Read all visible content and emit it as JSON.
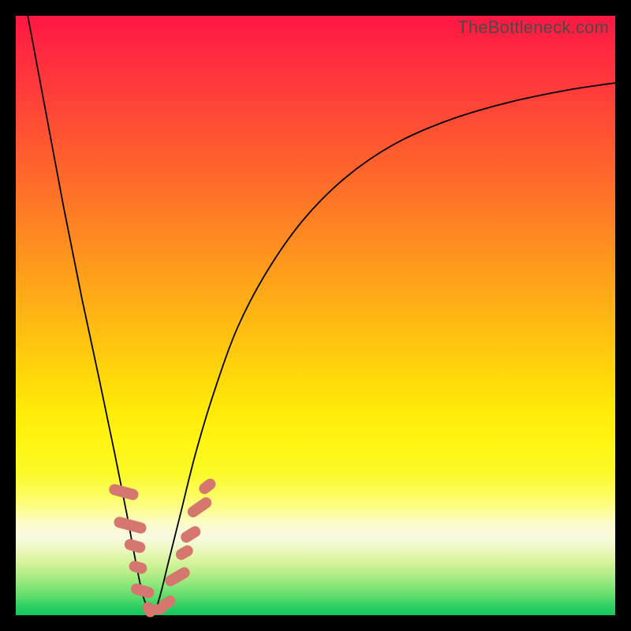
{
  "attribution": "TheBottleneck.com",
  "chart_data": {
    "type": "line",
    "title": "",
    "xlabel": "",
    "ylabel": "",
    "xlim": [
      0,
      100
    ],
    "ylim": [
      0,
      100
    ],
    "series": [
      {
        "name": "bottleneck-curve",
        "x": [
          2,
          5,
          8,
          11,
          14,
          16.5,
          18.5,
          20,
          21.3,
          22.8,
          24,
          25.5,
          27.5,
          30,
          33,
          37,
          42,
          48,
          55,
          63,
          72,
          82,
          92,
          100
        ],
        "y": [
          100,
          84,
          68,
          53,
          39,
          27,
          17,
          9,
          3,
          0,
          3,
          9,
          17,
          27,
          37,
          48,
          57.5,
          66,
          73,
          78.5,
          82.5,
          85.5,
          87.6,
          88.8
        ]
      }
    ],
    "markers": {
      "name": "data-points",
      "shape": "pill",
      "color": "#d5776e",
      "points": [
        {
          "x": 18.0,
          "y": 20.5,
          "w": 1.8,
          "h": 5.0,
          "rot": -75
        },
        {
          "x": 19.0,
          "y": 15.0,
          "w": 1.8,
          "h": 5.5,
          "rot": -75
        },
        {
          "x": 19.8,
          "y": 11.5,
          "w": 1.8,
          "h": 3.5,
          "rot": -74
        },
        {
          "x": 20.4,
          "y": 8.0,
          "w": 1.8,
          "h": 3.0,
          "rot": -74
        },
        {
          "x": 21.2,
          "y": 4.0,
          "w": 1.8,
          "h": 4.0,
          "rot": -74
        },
        {
          "x": 22.2,
          "y": 1.0,
          "w": 1.8,
          "h": 2.6,
          "rot": -30
        },
        {
          "x": 23.7,
          "y": 1.0,
          "w": 2.5,
          "h": 1.8,
          "rot": 0
        },
        {
          "x": 25.2,
          "y": 2.0,
          "w": 1.8,
          "h": 3.0,
          "rot": 55
        },
        {
          "x": 27.0,
          "y": 6.5,
          "w": 1.8,
          "h": 4.5,
          "rot": 60
        },
        {
          "x": 28.2,
          "y": 10.5,
          "w": 1.8,
          "h": 3.0,
          "rot": 60
        },
        {
          "x": 29.2,
          "y": 13.5,
          "w": 1.8,
          "h": 3.5,
          "rot": 58
        },
        {
          "x": 30.7,
          "y": 18.0,
          "w": 1.8,
          "h": 4.5,
          "rot": 55
        },
        {
          "x": 32.0,
          "y": 21.5,
          "w": 1.8,
          "h": 3.0,
          "rot": 52
        }
      ]
    },
    "background_gradient": {
      "top": "#ff1744",
      "mid_upper": "#ff8722",
      "mid": "#ffd70a",
      "mid_lower": "#fafa25",
      "bottom": "#11c85d"
    }
  }
}
